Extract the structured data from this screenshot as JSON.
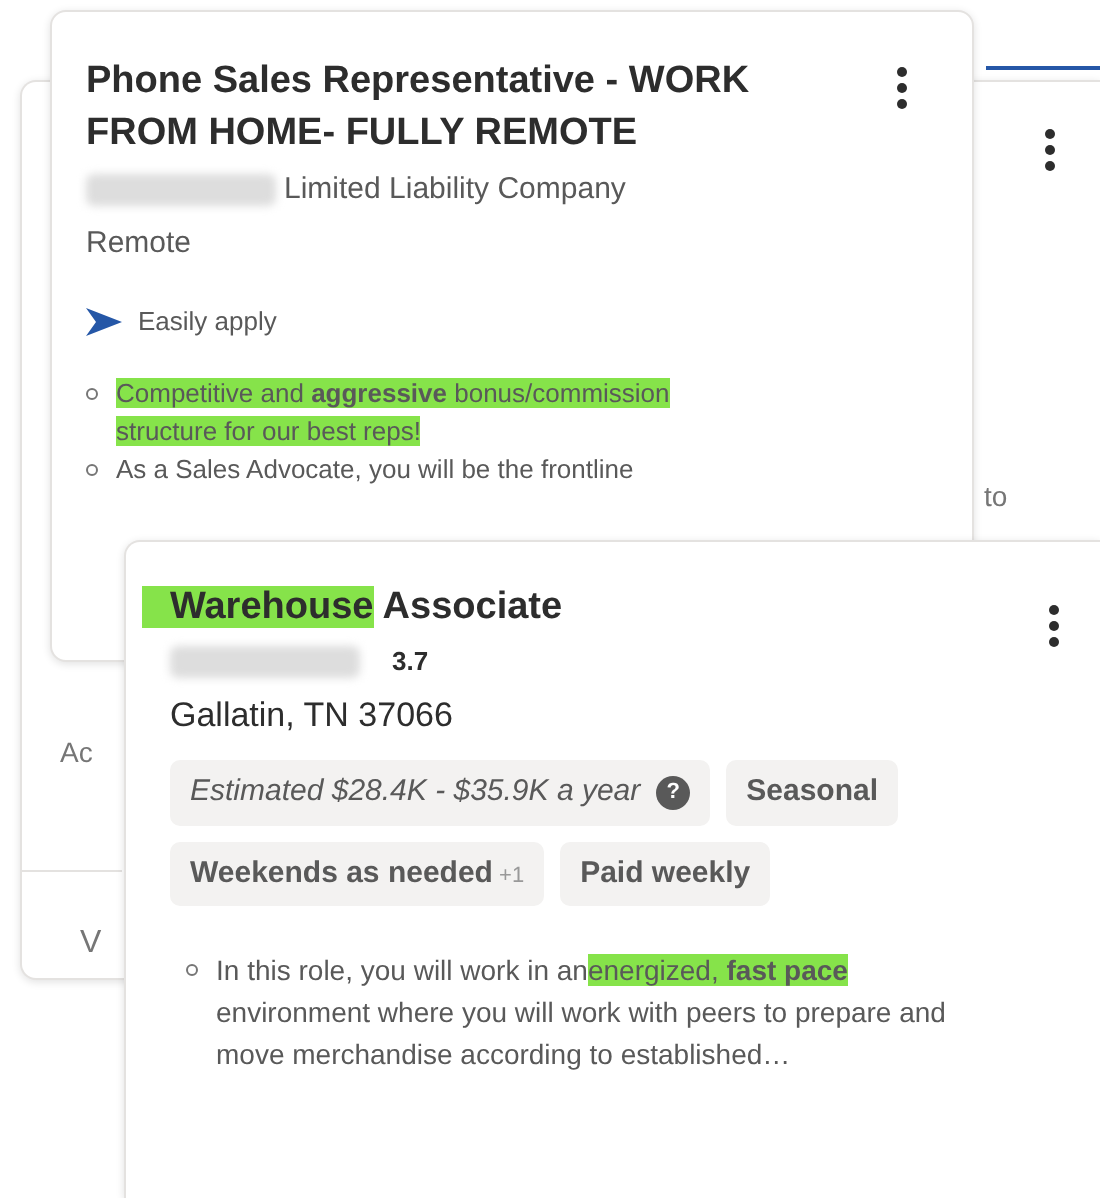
{
  "background_card": {
    "fragments": [
      {
        "kind": "right",
        "text": "to"
      },
      {
        "kind": "left",
        "text": "Ac"
      },
      {
        "kind": "left-low",
        "text": "V"
      }
    ]
  },
  "cards": [
    {
      "title": [
        {
          "text": "Phone Sales Representative - WORK FROM HOME- FULLY REMOTE",
          "highlighted": false
        }
      ],
      "company": "Limited Liability Company",
      "location": "Remote",
      "easily_apply": "Easily apply",
      "bullets": [
        [
          {
            "text": "Competitive and **aggressive** bonus/commission structure for our best reps!",
            "highlighted": true
          }
        ],
        [
          {
            "text": "As a Sales Advocate, you will be the frontline",
            "highlighted": false
          }
        ]
      ]
    },
    {
      "title": [
        {
          "text": "Warehouse",
          "highlighted": true
        },
        {
          "text": " Associate",
          "highlighted": false
        }
      ],
      "rating": "3.7",
      "location": "Gallatin, TN 37066",
      "chips": [
        {
          "kind": "salary",
          "text": "Estimated $28.4K - $35.9K a year",
          "help": "?"
        },
        {
          "kind": "tag",
          "text": "Seasonal"
        },
        {
          "kind": "tag",
          "text": "Weekends as needed",
          "extra": "+1"
        },
        {
          "kind": "tag",
          "text": "Paid weekly"
        }
      ],
      "bullets": [
        [
          {
            "text": "In this role, you will work in an",
            "highlighted": false
          },
          {
            "text": "energized, **fast pace**",
            "highlighted": true
          },
          {
            "text": " environment where you will work with peers to prepare and move merchandise according to established…",
            "highlighted": false
          }
        ]
      ]
    }
  ]
}
